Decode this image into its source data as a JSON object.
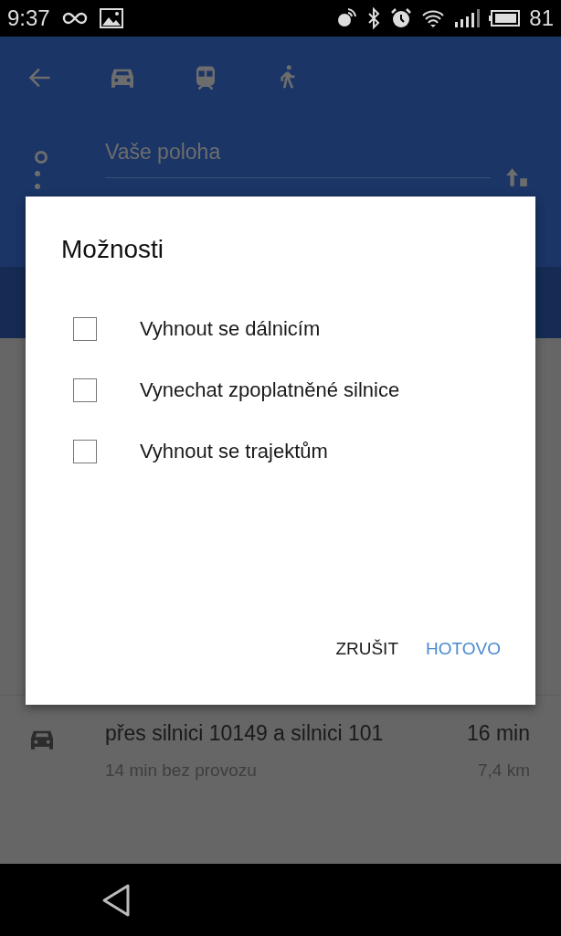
{
  "status_bar": {
    "time": "9:37",
    "battery": "81"
  },
  "header": {
    "origin_placeholder": "Vaše poloha"
  },
  "route": {
    "summary": "přes silnici 10149 a silnici 101",
    "duration": "16 min",
    "note": "14 min bez provozu",
    "distance": "7,4 km"
  },
  "dialog": {
    "title": "Možnosti",
    "options": [
      {
        "label": "Vyhnout se dálnicím",
        "checked": false
      },
      {
        "label": "Vynechat zpoplatněné silnice",
        "checked": false
      },
      {
        "label": "Vyhnout se trajektům",
        "checked": false
      }
    ],
    "buttons": [
      {
        "label": "ZRUŠIT",
        "kind": "neutral"
      },
      {
        "label": "HOTOVO",
        "kind": "primary"
      }
    ]
  }
}
